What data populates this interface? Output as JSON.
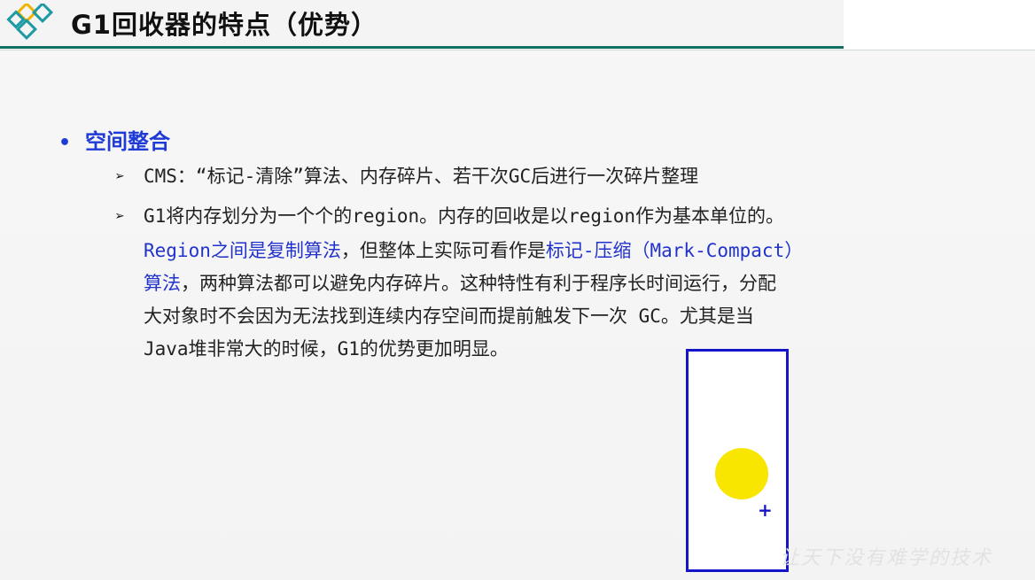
{
  "header": {
    "title": "G1回收器的特点（优势）"
  },
  "section": {
    "bullet": "•",
    "heading": "空间整合"
  },
  "items": [
    {
      "arrow": "➢",
      "text": "CMS：“标记-清除”算法、内存碎片、若干次GC后进行一次碎片整理"
    },
    {
      "arrow": "➢",
      "line1": "G1将内存划分为一个个的region。内存的回收是以region作为基本单位的。",
      "line2_blue_a": "Region之间是复制算法",
      "line2_black": "，但整体上实际可看作是",
      "line2_blue_b": "标记-压缩（Mark-Compact）",
      "line3_blue": "算法",
      "line3_black": "，两种算法都可以避免内存碎片。这种特性有利于程序长时间运行，分配",
      "line4": "大对象时不会因为无法找到连续内存空间而提前触发下一次 GC。尤其是当",
      "line5": "Java堆非常大的时候，G1的优势更加明显。"
    }
  ],
  "overlay": {
    "plus": "+"
  },
  "watermark": "让天下没有难学的技术",
  "colors": {
    "accent_teal": "#0f6f62",
    "section_blue": "#1f3bd6",
    "text_blue": "#2233cc",
    "box_blue": "#1515c8",
    "sun_yellow": "#f8e600"
  }
}
